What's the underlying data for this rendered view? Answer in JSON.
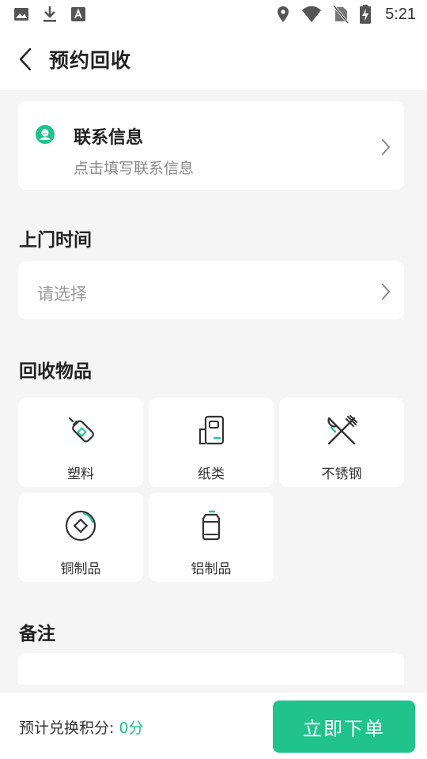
{
  "status_bar": {
    "time": "5:21",
    "left_icons": [
      "image-icon",
      "download-icon",
      "font-icon"
    ],
    "right_icons": [
      "location-icon",
      "wifi-icon",
      "no-sim-icon",
      "battery-charging-icon"
    ]
  },
  "header": {
    "title": "预约回收",
    "back_icon": "chevron-left-icon"
  },
  "contact": {
    "title": "联系信息",
    "subtitle": "点击填写联系信息",
    "icon": "user-avatar-icon"
  },
  "visit_time": {
    "section_title": "上门时间",
    "placeholder": "请选择"
  },
  "recycle_items": {
    "section_title": "回收物品",
    "items": [
      {
        "label": "塑料",
        "icon": "plastic-bottle-icon"
      },
      {
        "label": "纸类",
        "icon": "paper-icon"
      },
      {
        "label": "不锈钢",
        "icon": "cutlery-icon"
      },
      {
        "label": "铜制品",
        "icon": "copper-disc-icon"
      },
      {
        "label": "铝制品",
        "icon": "aluminum-can-icon"
      }
    ]
  },
  "notes": {
    "section_title": "备注"
  },
  "footer": {
    "points_label": "预计兑换积分: ",
    "points_value": "0分",
    "submit_label": "立即下单"
  },
  "colors": {
    "accent": "#1fc38b",
    "background": "#f5f5f5",
    "card": "#ffffff",
    "muted_text": "#888888"
  }
}
